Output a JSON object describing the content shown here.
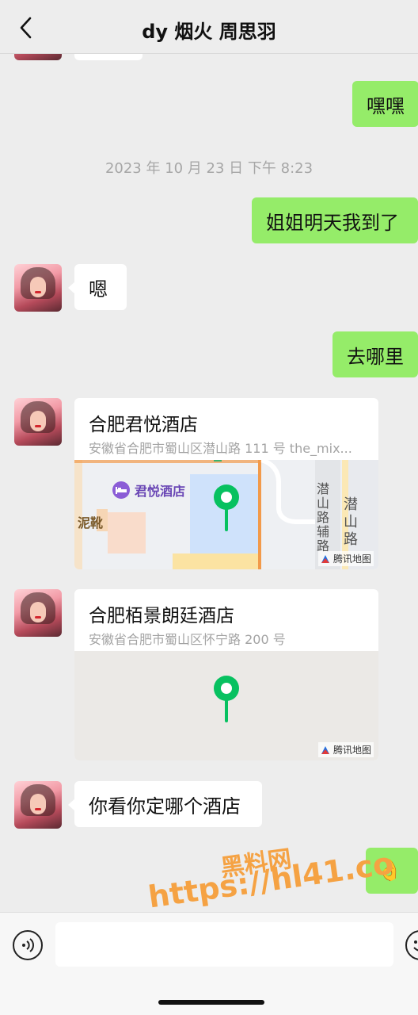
{
  "header": {
    "title": "dy 烟火 周思羽"
  },
  "messages": {
    "m1": "嘿嘿",
    "timestamp": "2023 年 10 月 23 日 下午 8:23",
    "m2": "姐姐明天我到了",
    "m3": "嗯",
    "m4": "去哪里",
    "m5": "你看你定哪个酒店",
    "m6": "👌"
  },
  "locations": [
    {
      "name": "合肥君悦酒店",
      "address": "安徽省合肥市蜀山区潜山路 111 号 the_mix...",
      "poi": "君悦酒店",
      "road1": "潜山路辅路",
      "road2": "潜山路",
      "place": "泥靴",
      "credit": "腾讯地图"
    },
    {
      "name": "合肥栢景朗廷酒店",
      "address": "安徽省合肥市蜀山区怀宁路 200 号",
      "credit": "腾讯地图"
    }
  ],
  "watermark": {
    "line1": "黑料网",
    "line2": "https://hl41.co"
  },
  "colors": {
    "bubble_right": "#95ec69",
    "bubble_left": "#ffffff",
    "pin": "#07c160",
    "background": "#ededed",
    "watermark": "#f5a243"
  },
  "icons": {
    "back": "chevron-left-icon",
    "voice": "voice-icon",
    "emoji": "emoji-icon",
    "pin": "map-pin-icon",
    "hotel": "bed-icon"
  }
}
